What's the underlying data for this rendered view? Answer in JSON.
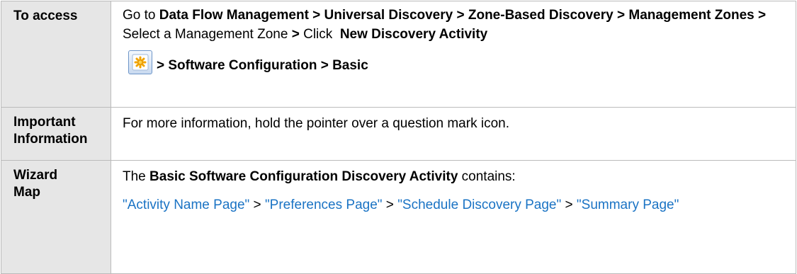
{
  "rows": {
    "access": {
      "label": "To access",
      "text_go_to": "Go to ",
      "path_1": "Data Flow Management > Universal Discovery > Zone-Based Discovery > Management Zones >",
      "text_select": " Select a Management Zone ",
      "arrow_1": ">",
      "text_click": " Click ",
      "path_2": "New Discovery Activity",
      "path_3": "> Software Configuration > Basic",
      "icon": "new-discovery-activity-icon"
    },
    "important": {
      "label_line1": "Important",
      "label_line2": "Information",
      "text": "For more information, hold the pointer over a question mark icon."
    },
    "wizard": {
      "label_line1": "Wizard",
      "label_line2": "Map",
      "intro_prefix": "The ",
      "intro_bold": "Basic Software Configuration Discovery Activity",
      "intro_suffix": " contains:",
      "links": [
        "\"Activity Name Page\"",
        "\"Preferences Page\"",
        "\"Schedule Discovery Page\"",
        "\"Summary Page\""
      ],
      "separator": " > "
    }
  },
  "colors": {
    "label_background": "#e6e6e6",
    "border": "#bbbbbb",
    "link": "#1a73c4"
  }
}
